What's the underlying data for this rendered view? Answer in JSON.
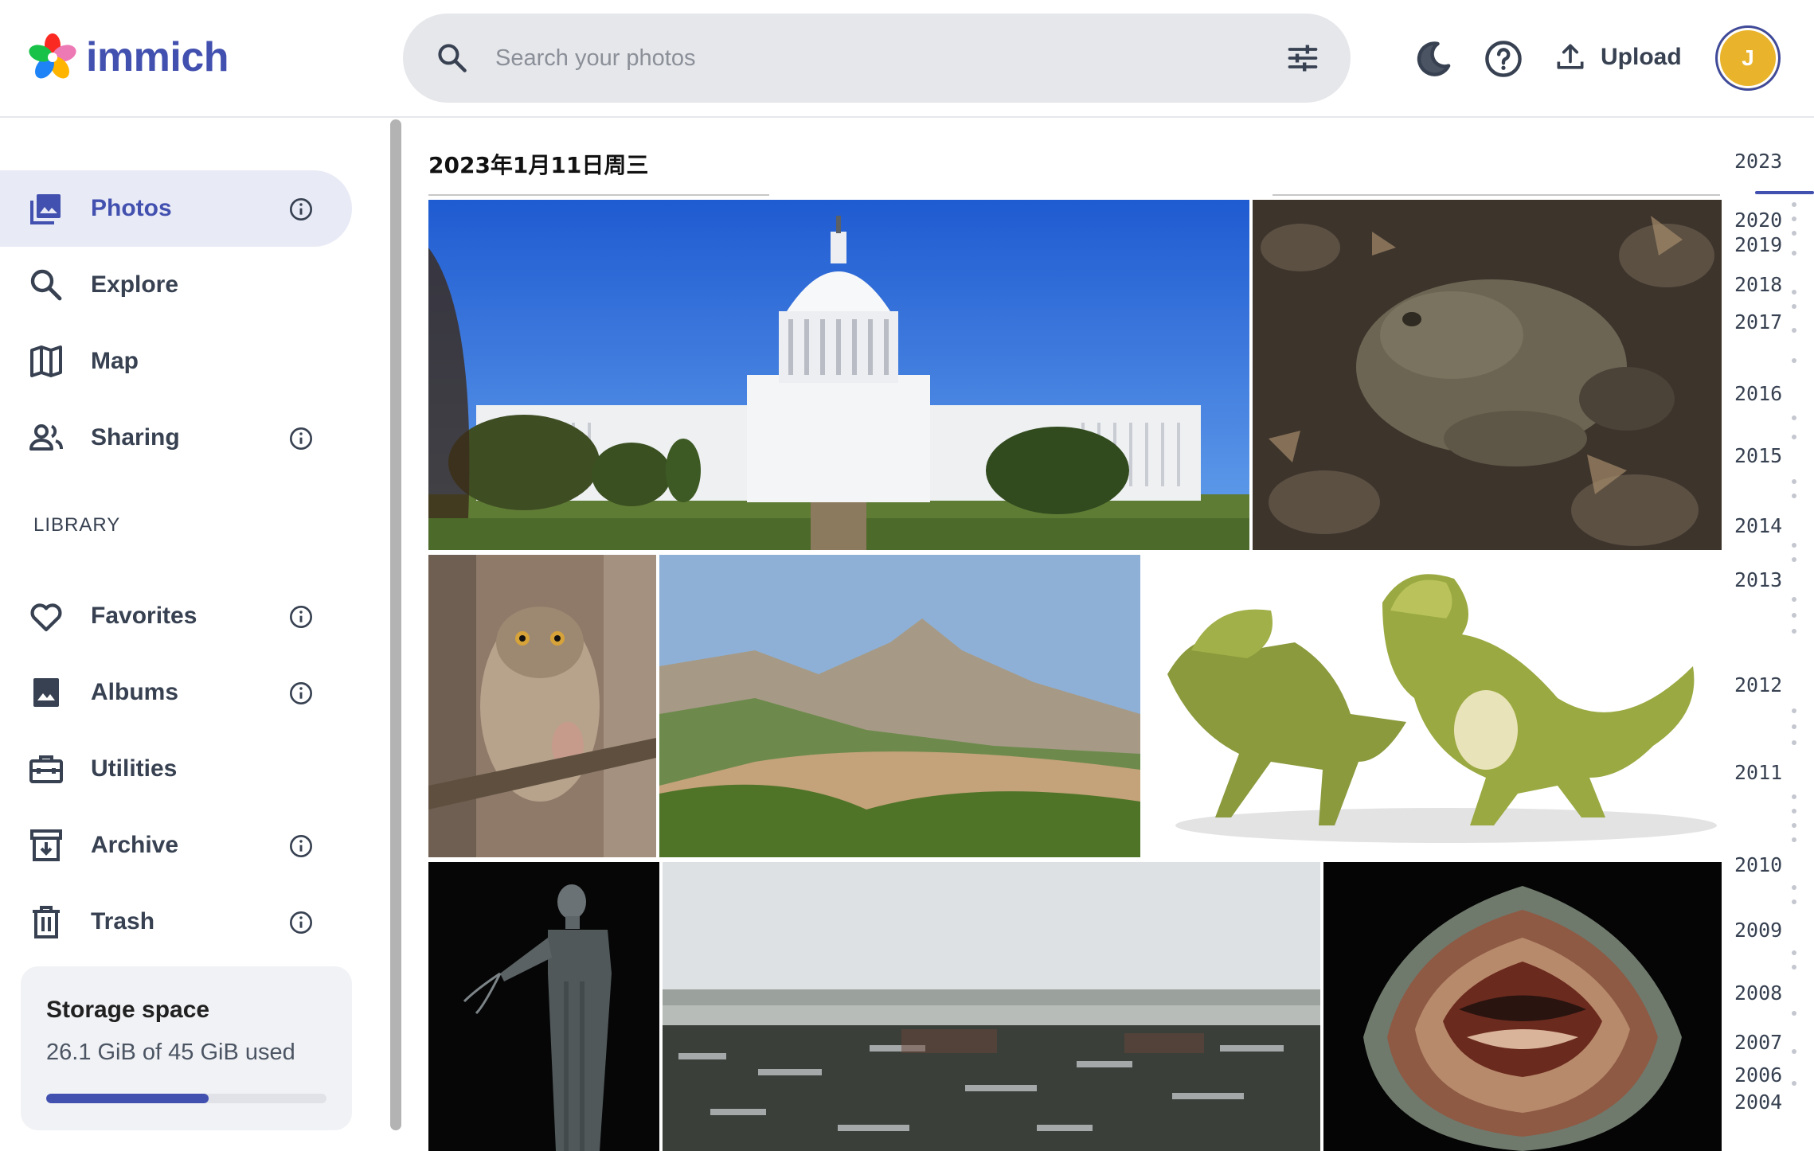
{
  "app": {
    "name": "immich"
  },
  "search": {
    "placeholder": "Search your photos"
  },
  "header": {
    "theme_icon": "moon-icon",
    "help_icon": "help-icon",
    "upload_label": "Upload",
    "avatar_initial": "J",
    "avatar_color": "#e9b42b"
  },
  "sidebar": {
    "items": [
      {
        "label": "Photos",
        "icon": "photos-icon",
        "info": true,
        "active": true
      },
      {
        "label": "Explore",
        "icon": "explore-icon",
        "info": false
      },
      {
        "label": "Map",
        "icon": "map-icon",
        "info": false
      },
      {
        "label": "Sharing",
        "icon": "sharing-icon",
        "info": true
      }
    ],
    "library_label": "LIBRARY",
    "library_items": [
      {
        "label": "Favorites",
        "icon": "heart-icon",
        "info": true
      },
      {
        "label": "Albums",
        "icon": "albums-icon",
        "info": true
      },
      {
        "label": "Utilities",
        "icon": "utilities-icon",
        "info": false
      },
      {
        "label": "Archive",
        "icon": "archive-icon",
        "info": true
      },
      {
        "label": "Trash",
        "icon": "trash-icon",
        "info": true
      }
    ],
    "storage": {
      "title": "Storage space",
      "used_text": "26.1 GiB of 45 GiB used",
      "used_fraction": 0.58
    }
  },
  "timeline": {
    "date_group": "2023年1月11日周三",
    "photos": [
      {
        "subject": "capitol-building-photo"
      },
      {
        "subject": "toad-photo"
      },
      {
        "subject": "owl-photo"
      },
      {
        "subject": "mountain-photo"
      },
      {
        "subject": "dinosaurs-illustration"
      },
      {
        "subject": "statue-photo"
      },
      {
        "subject": "snowy-forest-photo"
      },
      {
        "subject": "agate-photo"
      }
    ]
  },
  "scrubber": {
    "years": [
      "2023",
      "2020",
      "2019",
      "2018",
      "2017",
      "2016",
      "2015",
      "2014",
      "2013",
      "2012",
      "2011",
      "2010",
      "2009",
      "2008",
      "2007",
      "2006",
      "2004"
    ]
  },
  "colors": {
    "accent": "#4250af",
    "active_nav_bg": "#e8eaf6",
    "search_bg": "#e6e7eb"
  }
}
